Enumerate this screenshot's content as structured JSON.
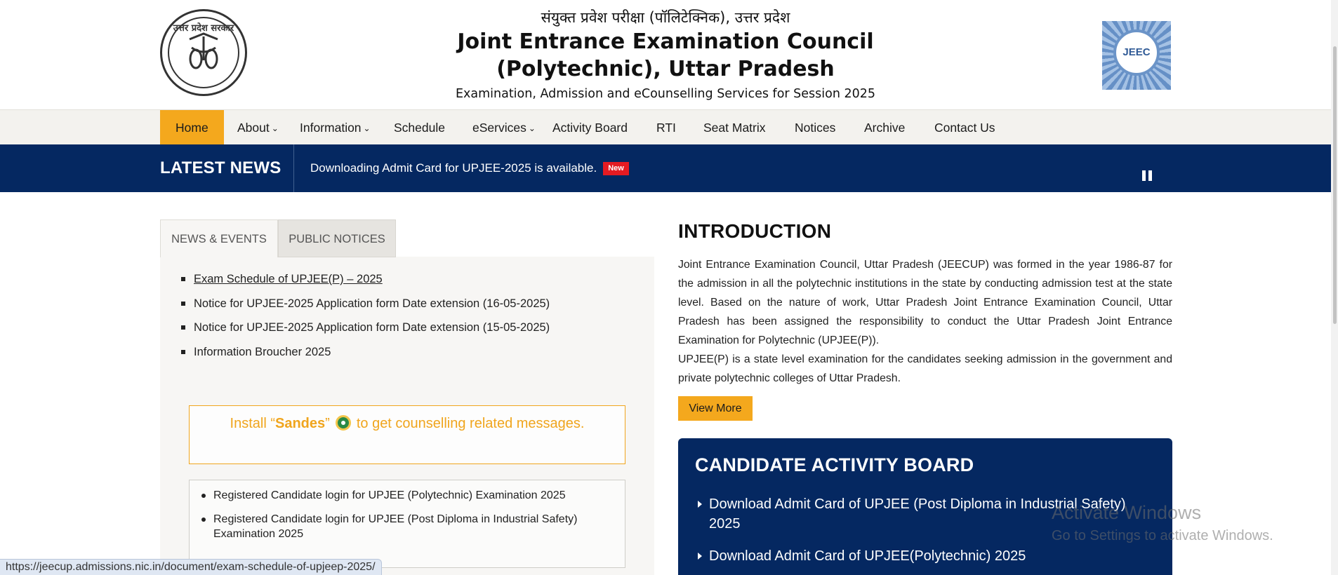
{
  "header": {
    "hindi_title": "संयुक्त प्रवेश परीक्षा (पॉलिटेक्निक), उत्तर प्रदेश",
    "title_line1": "Joint Entrance Examination Council",
    "title_line2": "(Polytechnic), Uttar Pradesh",
    "subtitle": "Examination, Admission and eCounselling Services for Session 2025",
    "emblem_text": "उत्तर प्रदेश सरकार",
    "logo_text": "JEEC"
  },
  "nav": {
    "items": [
      {
        "label": "Home",
        "active": true
      },
      {
        "label": "About",
        "dropdown": true
      },
      {
        "label": "Information",
        "dropdown": true
      },
      {
        "label": "Schedule"
      },
      {
        "label": "eServices",
        "dropdown": true
      },
      {
        "label": "Activity Board"
      },
      {
        "label": "RTI"
      },
      {
        "label": "Seat Matrix"
      },
      {
        "label": "Notices"
      },
      {
        "label": "Archive"
      },
      {
        "label": "Contact Us"
      }
    ],
    "chevron": "⌄"
  },
  "latest_news": {
    "label": "LATEST NEWS",
    "text": "Downloading Admit Card for UPJEE-2025 is available.",
    "badge": "New"
  },
  "tabs": {
    "items": [
      "NEWS & EVENTS",
      "PUBLIC NOTICES"
    ]
  },
  "news_events": [
    "Exam Schedule of UPJEE(P) – 2025",
    "Notice for UPJEE-2025 Application form Date extension (16-05-2025)",
    "Notice for UPJEE-2025 Application form Date extension (15-05-2025)",
    "Information Broucher 2025"
  ],
  "sandes": {
    "prefix": "Install “",
    "name": "Sandes",
    "suffix": "”",
    "rest": "to get counselling related messages."
  },
  "login_links": [
    "Registered Candidate login for UPJEE (Polytechnic) Examination 2025",
    "Registered Candidate login for UPJEE (Post Diploma in Industrial Safety) Examination 2025"
  ],
  "intro": {
    "title": "INTRODUCTION",
    "paragraph1": "Joint Entrance Examination Council, Uttar Pradesh (JEECUP) was formed in the year 1986-87 for the admission in all the polytechnic institutions in the state by conducting admission test at the state level. Based on the nature of work, Uttar Pradesh Joint Entrance Examination Council, Uttar Pradesh has been assigned the responsibility to conduct the Uttar Pradesh Joint Entrance Examination for Polytechnic (UPJEE(P)).",
    "paragraph2": "UPJEE(P) is a state level examination for the candidates seeking admission in the government and private polytechnic colleges of Uttar Pradesh.",
    "button": "View More"
  },
  "activity_board": {
    "title": "CANDIDATE ACTIVITY BOARD",
    "items": [
      "Download Admit Card of UPJEE (Post Diploma in Industrial Safety) 2025",
      "Download Admit Card of UPJEE(Polytechnic) 2025"
    ]
  },
  "watermark": {
    "line1": "Activate Windows",
    "line2": "Go to Settings to activate Windows."
  },
  "status_url": "https://jeecup.admissions.nic.in/document/exam-schedule-of-upjeep-2025/",
  "colors": {
    "accent": "#f4a81d",
    "navy": "#052861",
    "badge_red": "#e51b22"
  }
}
